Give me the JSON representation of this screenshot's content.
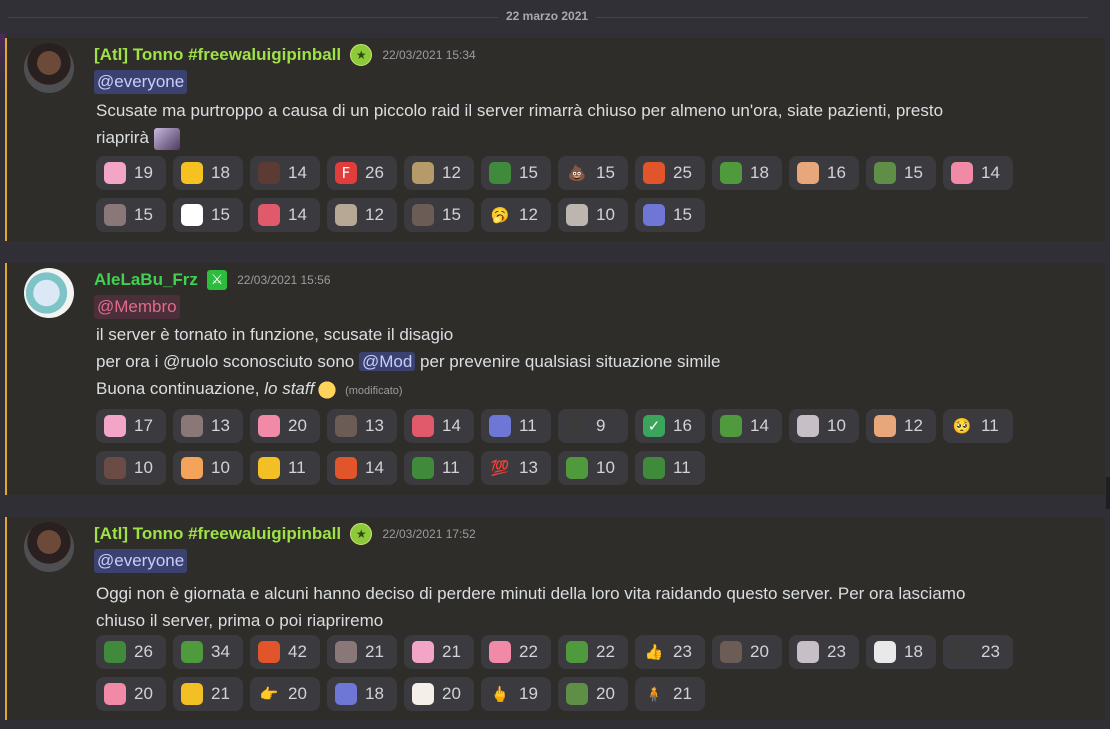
{
  "date_divider": "22 marzo 2021",
  "messages": [
    {
      "author": "[Atl] Tonno #freewaluigipinball",
      "timestamp": "22/03/2021 15:34",
      "mention": "@everyone",
      "lines": [
        "Scusate ma purtroppo a causa di un piccolo raid il server rimarrà chiuso per almeno un'ora, siate pazienti, presto",
        "riaprirà"
      ],
      "reactions": [
        [
          {
            "emoji": "pink-hair-anime-emoji",
            "color": "#f2a5c6",
            "count": "19"
          },
          {
            "emoji": "yellow-duck-emoji",
            "color": "#f5c221",
            "count": "18"
          },
          {
            "emoji": "hammer-emoji",
            "color": "#5c3b34",
            "count": "14"
          },
          {
            "emoji": "letter-f-emoji",
            "color": "#e23d3d",
            "glyph": "F",
            "count": "26"
          },
          {
            "emoji": "cat-meme-emoji",
            "color": "#b59a6a",
            "count": "12"
          },
          {
            "emoji": "turtle-emoji",
            "color": "#3f8a3b",
            "count": "15"
          },
          {
            "emoji": "poop-emoji",
            "color": "#a0522d",
            "glyph": "💩",
            "count": "15"
          },
          {
            "emoji": "angry-character-emoji",
            "color": "#e2552b",
            "count": "25"
          },
          {
            "emoji": "pepe-frog-emoji",
            "color": "#4f9a3c",
            "count": "18"
          },
          {
            "emoji": "shocked-face-emoji",
            "color": "#e8a77b",
            "count": "16"
          },
          {
            "emoji": "simp-pepe-emoji",
            "color": "#5f8e46",
            "count": "15"
          },
          {
            "emoji": "pink-girl-emoji",
            "color": "#f08aa6",
            "count": "14"
          }
        ],
        [
          {
            "emoji": "dog-meme-emoji",
            "color": "#8a7777",
            "count": "15"
          },
          {
            "emoji": "panda-emoji",
            "color": "#ffffff",
            "count": "15"
          },
          {
            "emoji": "red-bow-girl-emoji",
            "color": "#e05a6b",
            "count": "14"
          },
          {
            "emoji": "cat-photo-emoji",
            "color": "#b7a895",
            "count": "12"
          },
          {
            "emoji": "bird-meme-emoji",
            "color": "#6b5c56",
            "count": "15"
          },
          {
            "emoji": "yawning-face-emoji",
            "color": "#f2b631",
            "glyph": "🥱",
            "count": "12"
          },
          {
            "emoji": "sketch-face-emoji",
            "color": "#bdb5b0",
            "count": "10"
          },
          {
            "emoji": "blue-cat-emoji",
            "color": "#6e77d6",
            "count": "15"
          }
        ]
      ]
    },
    {
      "author": "AleLaBu_Frz",
      "timestamp": "22/03/2021 15:56",
      "mention": "@Membro",
      "line1": "il server è tornato in funzione, scusate il disagio",
      "line2_a": "per ora i @ruolo sconosciuto sono ",
      "line2_mention": "@Mod",
      "line2_b": " per prevenire qualsiasi situazione simile",
      "line3_a": "Buona continuazione, ",
      "line3_italic": "lo staff",
      "edited": "(modificato)",
      "reactions": [
        [
          {
            "emoji": "pink-hair-anime-emoji",
            "color": "#f2a5c6",
            "count": "17"
          },
          {
            "emoji": "dog-meme-emoji",
            "color": "#8a7777",
            "count": "13"
          },
          {
            "emoji": "pink-girl-emoji",
            "color": "#f08aa6",
            "count": "20"
          },
          {
            "emoji": "bird-meme-emoji",
            "color": "#6b5c56",
            "count": "13"
          },
          {
            "emoji": "red-bow-girl-emoji",
            "color": "#e05a6b",
            "count": "14"
          },
          {
            "emoji": "blue-cat-emoji",
            "color": "#6e77d6",
            "count": "11"
          },
          {
            "emoji": "ninja-face-emoji",
            "color": "#3b3b3b",
            "count": "9"
          },
          {
            "emoji": "check-mark-emoji",
            "color": "#3ba55c",
            "glyph": "✓",
            "count": "16"
          },
          {
            "emoji": "pepe-frog-emoji",
            "color": "#4f9a3c",
            "count": "14"
          },
          {
            "emoji": "anime-eyes-emoji",
            "color": "#c6c0c6",
            "count": "10"
          },
          {
            "emoji": "shocked-face-emoji",
            "color": "#e8a77b",
            "count": "12"
          },
          {
            "emoji": "pleading-face-emoji",
            "color": "#f7c948",
            "glyph": "🥺",
            "count": "11"
          }
        ],
        [
          {
            "emoji": "man-photo-emoji",
            "color": "#6b4b45",
            "count": "10"
          },
          {
            "emoji": "orange-hair-anime-emoji",
            "color": "#f4a35a",
            "count": "10"
          },
          {
            "emoji": "wave-face-emoji",
            "color": "#f2c024",
            "count": "11"
          },
          {
            "emoji": "angry-character-emoji",
            "color": "#e2552b",
            "count": "14"
          },
          {
            "emoji": "turtle-emoji",
            "color": "#3f8a3b",
            "count": "11"
          },
          {
            "emoji": "hundred-points-emoji",
            "color": "#d9283a",
            "glyph": "💯",
            "count": "13"
          },
          {
            "emoji": "pepe-laugh-emoji",
            "color": "#4f9a3c",
            "count": "10"
          },
          {
            "emoji": "small-turtle-emoji",
            "color": "#3f8a3b",
            "count": "11"
          }
        ]
      ]
    },
    {
      "author": "[Atl] Tonno #freewaluigipinball",
      "timestamp": "22/03/2021 17:52",
      "mention": "@everyone",
      "lines": [
        "Oggi non è giornata e alcuni hanno deciso di perdere minuti della loro vita raidando questo server. Per ora lasciamo",
        "chiuso il server, prima o poi riapriremo"
      ],
      "reactions": [
        [
          {
            "emoji": "turtle-emoji",
            "color": "#3f8a3b",
            "count": "26"
          },
          {
            "emoji": "pepe-frog-emoji",
            "color": "#4f9a3c",
            "count": "34"
          },
          {
            "emoji": "angry-character-emoji",
            "color": "#e2552b",
            "count": "42"
          },
          {
            "emoji": "dog-meme-emoji",
            "color": "#8a7777",
            "count": "21"
          },
          {
            "emoji": "pink-hair-anime-emoji",
            "color": "#f2a5c6",
            "count": "21"
          },
          {
            "emoji": "pink-girl-emoji",
            "color": "#f08aa6",
            "count": "22"
          },
          {
            "emoji": "pepe-laugh-emoji",
            "color": "#4f9a3c",
            "count": "22"
          },
          {
            "emoji": "thumbs-up-emoji",
            "color": "#f7c948",
            "glyph": "👍",
            "count": "23"
          },
          {
            "emoji": "bird-meme-emoji",
            "color": "#6b5c56",
            "count": "20"
          },
          {
            "emoji": "anime-eyes-emoji",
            "color": "#c6c0c6",
            "count": "23"
          },
          {
            "emoji": "troll-face-emoji",
            "color": "#e9e9e9",
            "count": "18"
          },
          {
            "emoji": "ninja-face-emoji",
            "color": "#3b3b3b",
            "count": "23"
          }
        ],
        [
          {
            "emoji": "pink-girl-emoji",
            "color": "#f08aa6",
            "count": "20"
          },
          {
            "emoji": "wave-face-emoji",
            "color": "#f2c024",
            "count": "21"
          },
          {
            "emoji": "pointing-hand-emoji",
            "color": "#f7c948",
            "glyph": "👉",
            "count": "20"
          },
          {
            "emoji": "blue-cat-emoji",
            "color": "#6e77d6",
            "count": "18"
          },
          {
            "emoji": "white-cat-emoji",
            "color": "#f4efe8",
            "count": "20"
          },
          {
            "emoji": "middle-finger-emoji",
            "color": "#f7c948",
            "glyph": "🖕",
            "count": "19"
          },
          {
            "emoji": "simp-pepe-emoji",
            "color": "#5f8e46",
            "count": "20"
          },
          {
            "emoji": "standing-person-emoji",
            "color": "#6fa6d8",
            "glyph": "🧍",
            "count": "21"
          }
        ]
      ]
    }
  ]
}
